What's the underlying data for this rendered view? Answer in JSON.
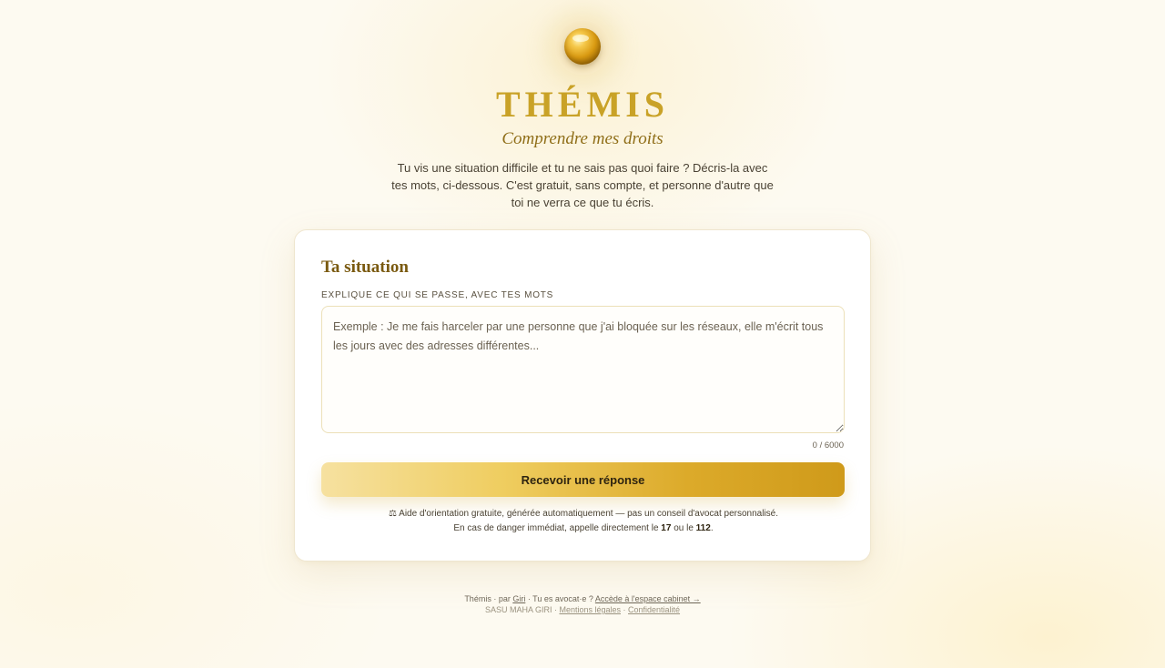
{
  "brand": {
    "name": "THÉMIS",
    "tagline": "Comprendre mes droits",
    "logo_icon": "golden-orb-icon"
  },
  "intro": "Tu vis une situation difficile et tu ne sais pas quoi faire ? Décris-la avec tes mots, ci-dessous. C'est gratuit, sans compte, et personne d'autre que toi ne verra ce que tu écris.",
  "form": {
    "title": "Ta situation",
    "label": "EXPLIQUE CE QUI SE PASSE, AVEC TES MOTS",
    "placeholder": "Exemple : Je me fais harceler par une personne que j'ai bloquée sur les réseaux, elle m'écrit tous les jours avec des adresses différentes...",
    "value": "",
    "counter": "0 / 6000",
    "submit_label": "Recevoir une réponse"
  },
  "disclaimer": {
    "line1": "⚖ Aide d'orientation gratuite, générée automatiquement — pas un conseil d'avocat personnalisé.",
    "line2_prefix": "En cas de danger immédiat, appelle directement le ",
    "emergency_1": "17",
    "line2_mid": " ou le ",
    "emergency_2": "112",
    "line2_suffix": "."
  },
  "footer": {
    "brand": "Thémis · par ",
    "author_link": "Giri",
    "lawyer_prompt": " · Tu es avocat·e ? ",
    "lawyer_link": "Accède à l'espace cabinet →",
    "company": "SASU MAHA GIRI · ",
    "legal_link": "Mentions légales",
    "separator": " · ",
    "privacy_link": "Confidentialité"
  },
  "colors": {
    "accent_gold": "#c9a227",
    "title_brown": "#7a5a10",
    "background": "#fdfaf1"
  }
}
